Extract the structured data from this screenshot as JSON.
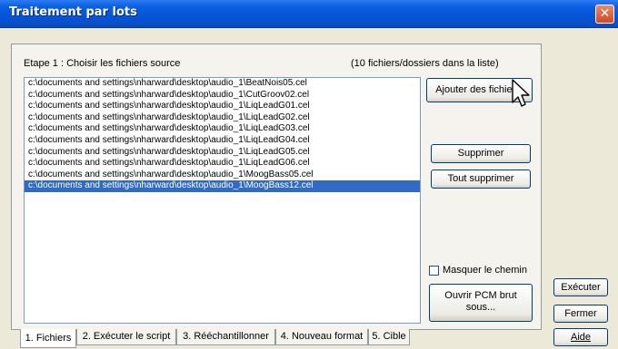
{
  "window": {
    "title": "Traitement par lots",
    "close_label": "✕"
  },
  "step": {
    "label": "Etape 1 :  Choisir les fichiers source",
    "count": "(10 fichiers/dossiers dans la liste)"
  },
  "files": [
    "c:\\documents and settings\\nharward\\desktop\\audio_1\\BeatNois05.cel",
    "c:\\documents and settings\\nharward\\desktop\\audio_1\\CutGroov02.cel",
    "c:\\documents and settings\\nharward\\desktop\\audio_1\\LiqLeadG01.cel",
    "c:\\documents and settings\\nharward\\desktop\\audio_1\\LiqLeadG02.cel",
    "c:\\documents and settings\\nharward\\desktop\\audio_1\\LiqLeadG03.cel",
    "c:\\documents and settings\\nharward\\desktop\\audio_1\\LiqLeadG04.cel",
    "c:\\documents and settings\\nharward\\desktop\\audio_1\\LiqLeadG05.cel",
    "c:\\documents and settings\\nharward\\desktop\\audio_1\\LiqLeadG06.cel",
    "c:\\documents and settings\\nharward\\desktop\\audio_1\\MoogBass05.cel",
    "c:\\documents and settings\\nharward\\desktop\\audio_1\\MoogBass12.cel"
  ],
  "selected_file_index": 9,
  "buttons": {
    "add": "Ajouter des fichie ...",
    "remove": "Supprimer",
    "remove_all": "Tout supprimer",
    "open_pcm": "Ouvrir PCM brut sous...",
    "execute": "Exécuter",
    "close": "Fermer",
    "help": "Aide"
  },
  "hide_path": {
    "label": "Masquer le chemin",
    "checked": false
  },
  "tabs": [
    "1. Fichiers",
    "2. Exécuter le script",
    "3. Rééchantillonner",
    "4. Nouveau format",
    "5. Cible"
  ],
  "active_tab": 0,
  "colors": {
    "titlebar": "#0a5fe0",
    "selection": "#316ac5",
    "close_button": "#d6461f"
  }
}
